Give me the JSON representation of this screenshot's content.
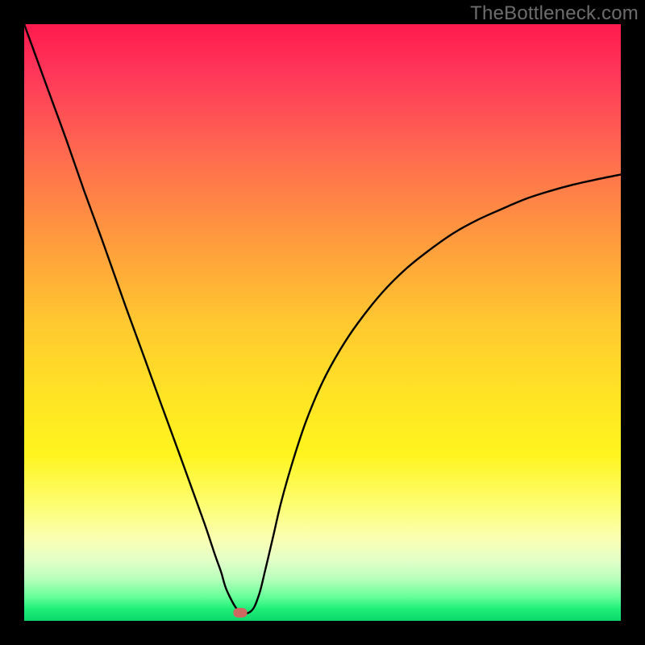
{
  "watermark": "TheBottleneck.com",
  "marker": {
    "x_frac": 0.362,
    "y_frac": 0.987
  },
  "chart_data": {
    "type": "line",
    "title": "",
    "xlabel": "",
    "ylabel": "",
    "xlim": [
      0,
      1
    ],
    "ylim": [
      0,
      1
    ],
    "series": [
      {
        "name": "bottleneck-curve",
        "x": [
          0.0,
          0.04,
          0.07,
          0.1,
          0.13,
          0.17,
          0.2,
          0.23,
          0.26,
          0.29,
          0.305,
          0.32,
          0.33,
          0.34,
          0.36,
          0.38,
          0.393,
          0.404,
          0.417,
          0.431,
          0.451,
          0.473,
          0.5,
          0.53,
          0.56,
          0.6,
          0.64,
          0.68,
          0.72,
          0.76,
          0.8,
          0.84,
          0.88,
          0.92,
          0.96,
          1.0
        ],
        "y": [
          1.0,
          0.89,
          0.808,
          0.722,
          0.64,
          0.527,
          0.445,
          0.362,
          0.28,
          0.197,
          0.155,
          0.11,
          0.082,
          0.05,
          0.016,
          0.016,
          0.042,
          0.085,
          0.14,
          0.2,
          0.27,
          0.336,
          0.4,
          0.455,
          0.5,
          0.55,
          0.59,
          0.622,
          0.65,
          0.672,
          0.69,
          0.707,
          0.72,
          0.731,
          0.74,
          0.748
        ]
      }
    ],
    "marker": {
      "x": 0.362,
      "y": 0.013
    },
    "gradient_stops": [
      {
        "pos": 0.0,
        "color": "#ff1a4d"
      },
      {
        "pos": 0.5,
        "color": "#ffc830"
      },
      {
        "pos": 0.8,
        "color": "#fdfd6c"
      },
      {
        "pos": 1.0,
        "color": "#0ad96b"
      }
    ]
  }
}
